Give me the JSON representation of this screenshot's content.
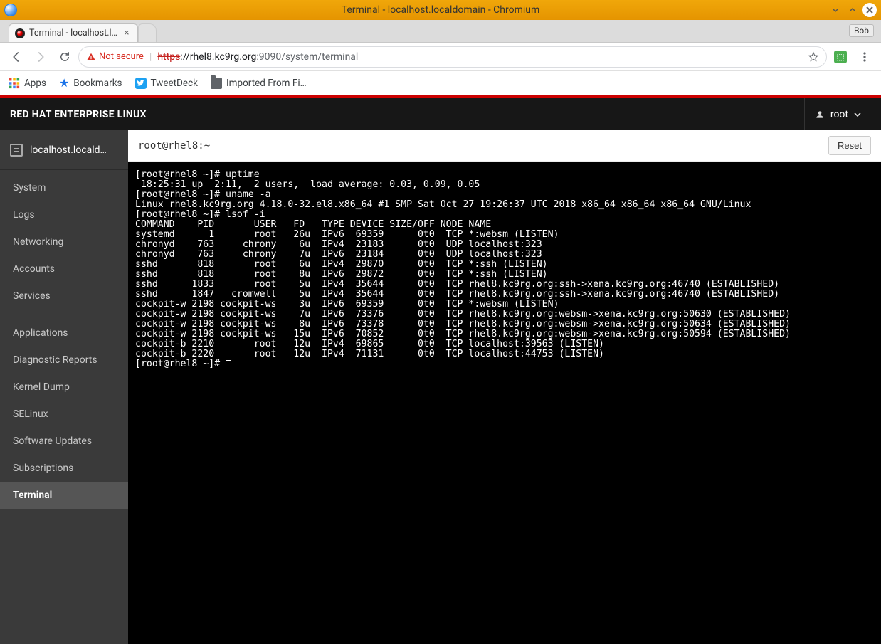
{
  "window": {
    "title": "Terminal - localhost.localdomain - Chromium",
    "bob_badge": "Bob"
  },
  "browser": {
    "tab_title": "Terminal - localhost.l…",
    "not_secure_label": "Not secure",
    "url_proto": "https",
    "url_host": "//rhel8.kc9rg.org",
    "url_port": ":9090",
    "url_path": "/system/terminal",
    "bookmarks": {
      "apps": "Apps",
      "bookmarks": "Bookmarks",
      "tweetdeck": "TweetDeck",
      "imported": "Imported From Fi…"
    }
  },
  "masthead": {
    "brand": "RED HAT ENTERPRISE LINUX",
    "user": "root"
  },
  "sidebar": {
    "host": "localhost.locald…",
    "items": [
      {
        "label": "System"
      },
      {
        "label": "Logs"
      },
      {
        "label": "Networking"
      },
      {
        "label": "Accounts"
      },
      {
        "label": "Services"
      },
      {
        "label": "Applications"
      },
      {
        "label": "Diagnostic Reports"
      },
      {
        "label": "Kernel Dump"
      },
      {
        "label": "SELinux"
      },
      {
        "label": "Software Updates"
      },
      {
        "label": "Subscriptions"
      },
      {
        "label": "Terminal"
      }
    ],
    "active_index": 11
  },
  "terminal": {
    "breadcrumb": "root@rhel8:~",
    "reset_label": "Reset",
    "lines": [
      "[root@rhel8 ~]# uptime",
      " 18:25:31 up  2:11,  2 users,  load average: 0.03, 0.09, 0.05",
      "[root@rhel8 ~]# uname -a",
      "Linux rhel8.kc9rg.org 4.18.0-32.el8.x86_64 #1 SMP Sat Oct 27 19:26:37 UTC 2018 x86_64 x86_64 x86_64 GNU/Linux",
      "[root@rhel8 ~]# lsof -i",
      "COMMAND    PID       USER   FD   TYPE DEVICE SIZE/OFF NODE NAME",
      "systemd      1       root   26u  IPv6  69359      0t0  TCP *:websm (LISTEN)",
      "chronyd    763     chrony    6u  IPv4  23183      0t0  UDP localhost:323",
      "chronyd    763     chrony    7u  IPv6  23184      0t0  UDP localhost:323",
      "sshd       818       root    6u  IPv4  29870      0t0  TCP *:ssh (LISTEN)",
      "sshd       818       root    8u  IPv6  29872      0t0  TCP *:ssh (LISTEN)",
      "sshd      1833       root    5u  IPv4  35644      0t0  TCP rhel8.kc9rg.org:ssh->xena.kc9rg.org:46740 (ESTABLISHED)",
      "sshd      1847   cromwell    5u  IPv4  35644      0t0  TCP rhel8.kc9rg.org:ssh->xena.kc9rg.org:46740 (ESTABLISHED)",
      "cockpit-w 2198 cockpit-ws    3u  IPv6  69359      0t0  TCP *:websm (LISTEN)",
      "cockpit-w 2198 cockpit-ws    7u  IPv6  73376      0t0  TCP rhel8.kc9rg.org:websm->xena.kc9rg.org:50630 (ESTABLISHED)",
      "cockpit-w 2198 cockpit-ws    8u  IPv6  73378      0t0  TCP rhel8.kc9rg.org:websm->xena.kc9rg.org:50634 (ESTABLISHED)",
      "cockpit-w 2198 cockpit-ws   15u  IPv6  70852      0t0  TCP rhel8.kc9rg.org:websm->xena.kc9rg.org:50594 (ESTABLISHED)",
      "cockpit-b 2210       root   12u  IPv4  69865      0t0  TCP localhost:39563 (LISTEN)",
      "cockpit-b 2220       root   12u  IPv4  71131      0t0  TCP localhost:44753 (LISTEN)"
    ],
    "prompt": "[root@rhel8 ~]# "
  }
}
